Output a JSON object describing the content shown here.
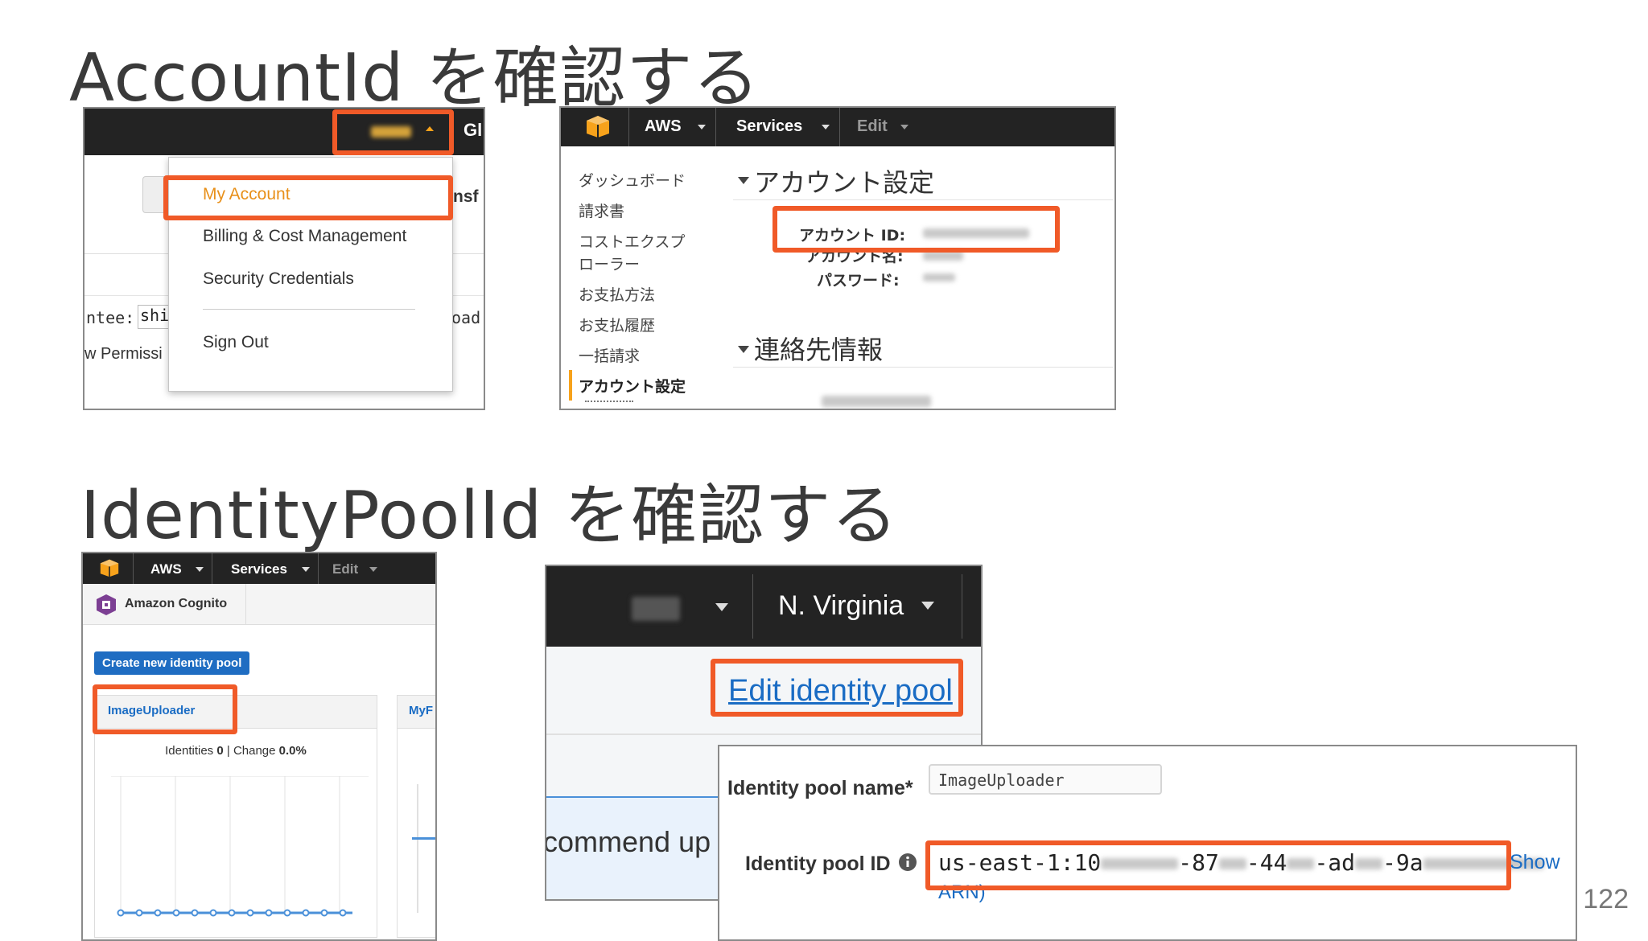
{
  "slide": {
    "title_account": "AccountId を確認する",
    "title_identity": "IdentityPoolId を確認する",
    "page_number": "122"
  },
  "shot1": {
    "gl_partial": "Gl",
    "nsf_partial": "nsf",
    "ntee_partial": "ntee:",
    "shir_partial": "shir",
    "oad_partial": "oad,",
    "permiss_partial": "w Permissi",
    "menu": {
      "my_account": "My Account",
      "billing": "Billing & Cost Management",
      "security": "Security Credentials",
      "sign_out": "Sign Out"
    }
  },
  "shot2": {
    "nav": {
      "aws": "AWS",
      "services": "Services",
      "edit": "Edit"
    },
    "sidebar": [
      "ダッシュボード",
      "請求書",
      "コストエクスプ",
      "ローラー",
      "お支払方法",
      "お支払履歴",
      "一括請求",
      "アカウント設定"
    ],
    "section_account": "アカウント設定",
    "account_id_label": "アカウント ID:",
    "account_name_label": "アカウント名:",
    "password_label": "パスワード:",
    "section_contact": "連絡先情報"
  },
  "shot3": {
    "nav": {
      "aws": "AWS",
      "services": "Services",
      "edit": "Edit"
    },
    "service_name": "Amazon Cognito",
    "create_button": "Create new identity pool",
    "pool_name": "ImageUploader",
    "pool_partial": "MyF",
    "identities_label": "Identities",
    "identities_value": "0",
    "change_label": "Change",
    "change_value": "0.0%"
  },
  "shot4": {
    "region": "N. Virginia",
    "edit_link": "Edit identity pool",
    "recommend_partial": "commend up"
  },
  "shot5": {
    "pool_name_label": "Identity pool name*",
    "pool_name_value": "ImageUploader",
    "pool_id_label": "Identity pool ID",
    "pool_id_value": "us-east-1:10",
    "pool_id_parts": [
      "-87",
      "-44",
      "-ad",
      "-9a"
    ],
    "show_link": "Show",
    "arn_partial": "ARN)"
  },
  "colors": {
    "highlight": "#f05a28",
    "aws_bar": "#232323",
    "aws_orange": "#f7a21b",
    "link_blue": "#1a6cc4",
    "button_blue": "#1f6dc2"
  }
}
